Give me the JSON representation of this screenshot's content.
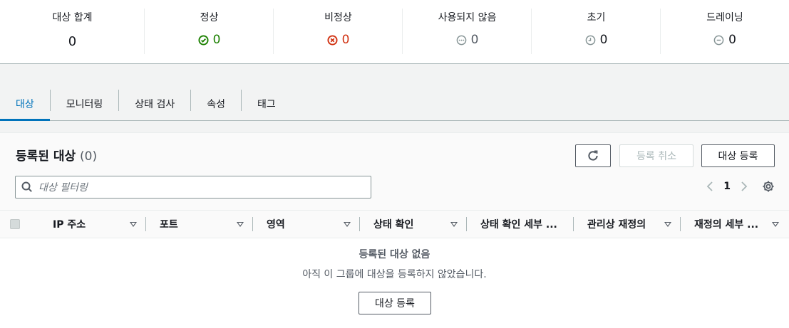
{
  "summary": [
    {
      "label": "대상 합계",
      "value": "0",
      "icon": "none"
    },
    {
      "label": "정상",
      "value": "0",
      "icon": "check-circle-icon",
      "color": "#1d8102"
    },
    {
      "label": "비정상",
      "value": "0",
      "icon": "x-circle-icon",
      "color": "#d13212"
    },
    {
      "label": "사용되지 않음",
      "value": "0",
      "icon": "ellipsis-circle-icon",
      "color": "#879596"
    },
    {
      "label": "초기",
      "value": "0",
      "icon": "clock-icon",
      "color": "#879596"
    },
    {
      "label": "드레이닝",
      "value": "0",
      "icon": "minus-circle-icon",
      "color": "#879596"
    }
  ],
  "tabs": [
    {
      "label": "대상",
      "active": true
    },
    {
      "label": "모니터링"
    },
    {
      "label": "상태 검사"
    },
    {
      "label": "속성"
    },
    {
      "label": "태그"
    }
  ],
  "panel": {
    "title": "등록된 대상",
    "count": "(0)",
    "deregister_label": "등록 취소",
    "register_label": "대상 등록",
    "search_placeholder": "대상 필터링",
    "page": "1"
  },
  "table": {
    "columns": [
      "IP 주소",
      "포트",
      "영역",
      "상태 확인",
      "상태 확인 세부 ...",
      "관리상 재정의",
      "재정의 세부 ..."
    ]
  },
  "empty": {
    "title": "등록된 대상 없음",
    "message": "아직 이 그룹에 대상을 등록하지 않았습니다.",
    "button_label": "대상 등록"
  },
  "colors": {
    "accent": "#0073bb",
    "healthy": "#1d8102",
    "unhealthy": "#d13212"
  }
}
